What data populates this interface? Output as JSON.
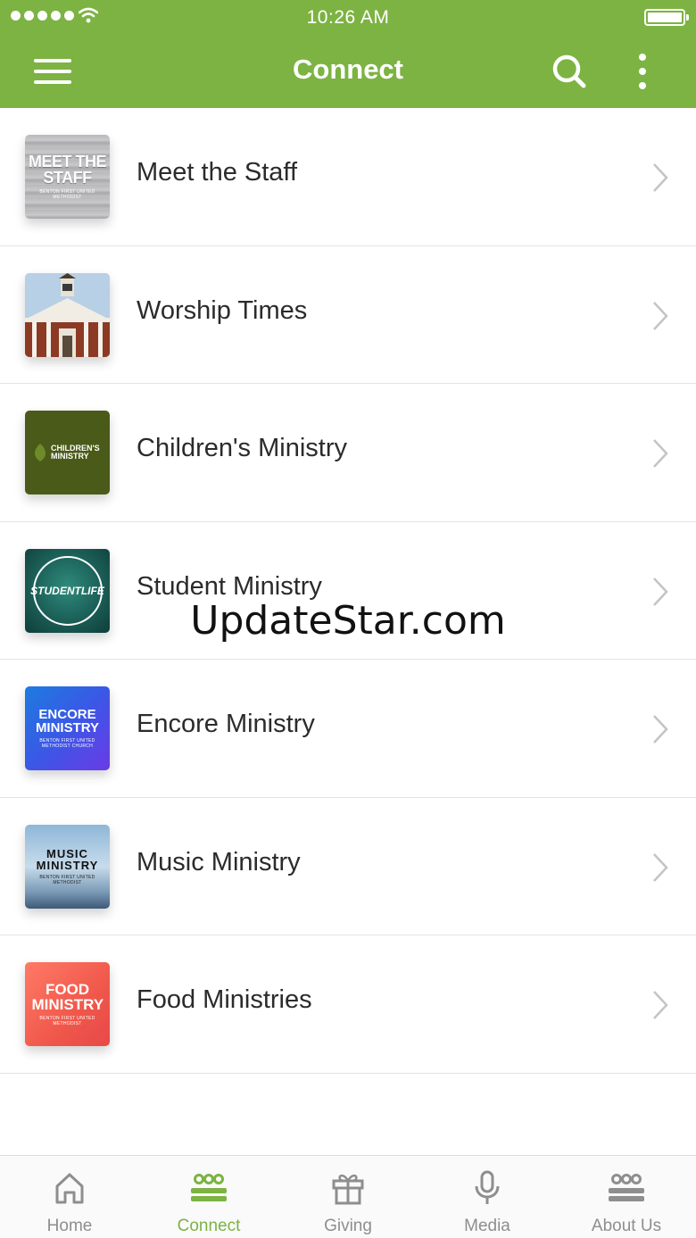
{
  "status_bar": {
    "time": "10:26 AM",
    "signal_icon": "signal-dots-icon",
    "wifi_icon": "wifi-icon",
    "battery_icon": "battery-icon"
  },
  "nav": {
    "title": "Connect",
    "menu_icon": "hamburger-icon",
    "search_icon": "search-icon",
    "more_icon": "more-vertical-icon"
  },
  "colors": {
    "accent": "#7cb342",
    "tab_inactive": "#8e8e8e",
    "text": "#2b2b2b"
  },
  "list": [
    {
      "label": "Meet the Staff",
      "thumb_title": "MEET THE STAFF",
      "thumb_sub": "BENTON FIRST UNITED METHODIST"
    },
    {
      "label": "Worship Times",
      "thumb_title": "",
      "thumb_sub": ""
    },
    {
      "label": "Children's Ministry",
      "thumb_title": "CHILDREN'S MINISTRY",
      "thumb_sub": ""
    },
    {
      "label": "Student Ministry",
      "thumb_title": "STUDENTLIFE",
      "thumb_sub": ""
    },
    {
      "label": "Encore Ministry",
      "thumb_title": "ENCORE MINISTRY",
      "thumb_sub": "BENTON FIRST UNITED METHODIST CHURCH"
    },
    {
      "label": "Music Ministry",
      "thumb_title": "MUSIC MINISTRY",
      "thumb_sub": "BENTON FIRST UNITED METHODIST"
    },
    {
      "label": "Food Ministries",
      "thumb_title": "FOOD MINISTRY",
      "thumb_sub": "BENTON FIRST UNITED METHODIST"
    }
  ],
  "watermark": "UpdateStar.com",
  "tabs": [
    {
      "label": "Home",
      "icon": "home-icon",
      "active": false
    },
    {
      "label": "Connect",
      "icon": "connect-icon",
      "active": true
    },
    {
      "label": "Giving",
      "icon": "gift-icon",
      "active": false
    },
    {
      "label": "Media",
      "icon": "microphone-icon",
      "active": false
    },
    {
      "label": "About Us",
      "icon": "people-icon",
      "active": false
    }
  ]
}
